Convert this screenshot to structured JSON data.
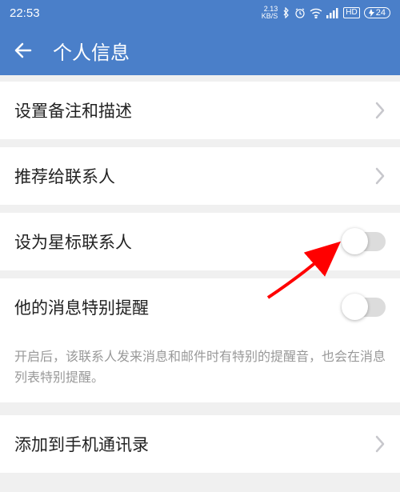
{
  "status": {
    "time": "22:53",
    "speed_top": "2.13",
    "speed_bottom": "KB/S",
    "battery": "24"
  },
  "header": {
    "title": "个人信息"
  },
  "rows": {
    "remark": "设置备注和描述",
    "recommend": "推荐给联系人",
    "star": "设为星标联系人",
    "notify": "他的消息特别提醒",
    "addcontact": "添加到手机通讯录"
  },
  "helper": "开启后，该联系人发来消息和邮件时有特别的提醒音，也会在消息列表特别提醒。"
}
